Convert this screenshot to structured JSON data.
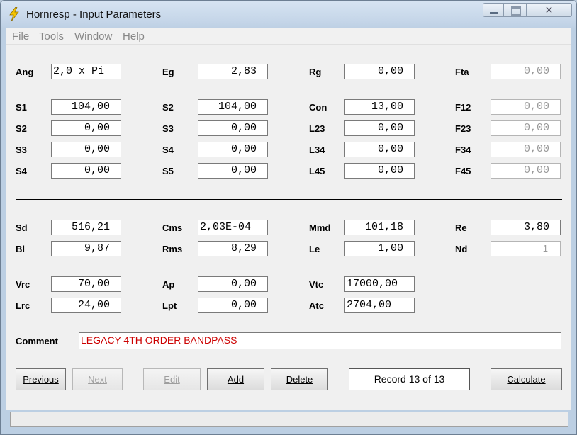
{
  "window": {
    "title": "Hornresp - Input Parameters"
  },
  "menu": [
    "File",
    "Tools",
    "Window",
    "Help"
  ],
  "row1": [
    {
      "label": "Ang",
      "value": "2,0 x Pi"
    },
    {
      "label": "Eg",
      "value": "2,83"
    },
    {
      "label": "Rg",
      "value": "0,00"
    },
    {
      "label": "Fta",
      "value": "0,00"
    }
  ],
  "horn_rows": [
    [
      {
        "label": "S1",
        "value": "104,00"
      },
      {
        "label": "S2",
        "value": "104,00"
      },
      {
        "label": "Con",
        "value": "13,00"
      },
      {
        "label": "F12",
        "value": "0,00"
      }
    ],
    [
      {
        "label": "S2",
        "value": "0,00"
      },
      {
        "label": "S3",
        "value": "0,00"
      },
      {
        "label": "L23",
        "value": "0,00"
      },
      {
        "label": "F23",
        "value": "0,00"
      }
    ],
    [
      {
        "label": "S3",
        "value": "0,00"
      },
      {
        "label": "S4",
        "value": "0,00"
      },
      {
        "label": "L34",
        "value": "0,00"
      },
      {
        "label": "F34",
        "value": "0,00"
      }
    ],
    [
      {
        "label": "S4",
        "value": "0,00"
      },
      {
        "label": "S5",
        "value": "0,00"
      },
      {
        "label": "L45",
        "value": "0,00"
      },
      {
        "label": "F45",
        "value": "0,00"
      }
    ]
  ],
  "driver_rows": [
    [
      {
        "label": "Sd",
        "value": "516,21"
      },
      {
        "label": "Cms",
        "value": "2,03E-04"
      },
      {
        "label": "Mmd",
        "value": "101,18"
      },
      {
        "label": "Re",
        "value": "3,80"
      }
    ],
    [
      {
        "label": "Bl",
        "value": "9,87"
      },
      {
        "label": "Rms",
        "value": "8,29"
      },
      {
        "label": "Le",
        "value": "1,00"
      },
      {
        "label": "Nd",
        "value": "1"
      }
    ]
  ],
  "chamber_rows": [
    [
      {
        "label": "Vrc",
        "value": "70,00"
      },
      {
        "label": "Ap",
        "value": "0,00"
      },
      {
        "label": "Vtc",
        "value": "17000,00"
      }
    ],
    [
      {
        "label": "Lrc",
        "value": "24,00"
      },
      {
        "label": "Lpt",
        "value": "0,00"
      },
      {
        "label": "Atc",
        "value": "2704,00"
      }
    ]
  ],
  "comment": {
    "label": "Comment",
    "value": "LEGACY 4TH ORDER BANDPASS"
  },
  "buttons": {
    "previous": "Previous",
    "next": "Next",
    "edit": "Edit",
    "add": "Add",
    "delete": "Delete",
    "calculate": "Calculate"
  },
  "record_status": "Record 13 of 13",
  "colors": {
    "comment_text": "#cc0000",
    "disabled_text": "#9a9a9a"
  }
}
